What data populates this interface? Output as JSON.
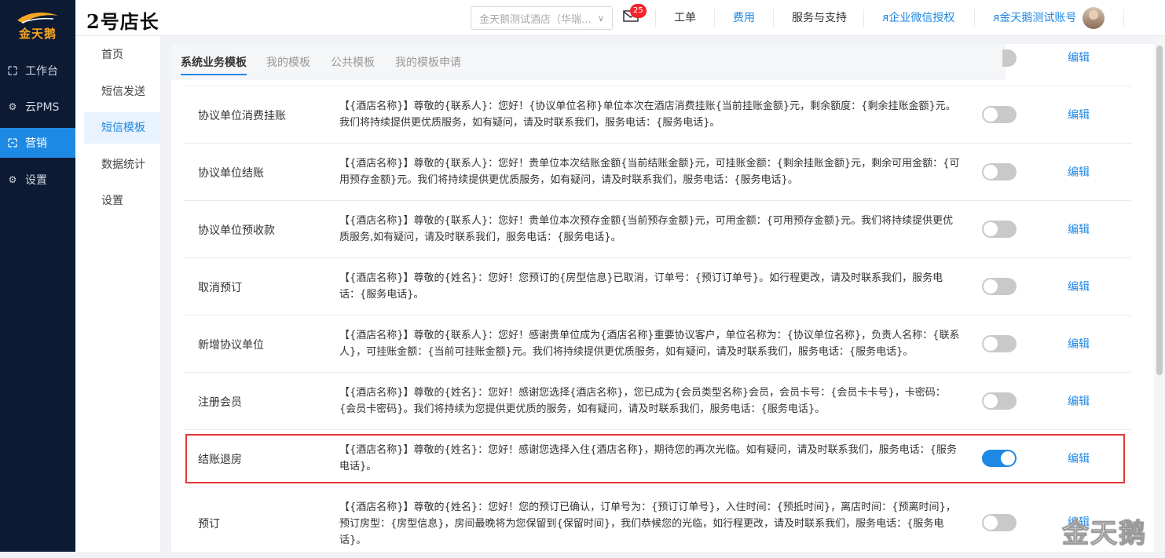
{
  "logo": {
    "text": "金天鹅"
  },
  "sidebar": {
    "items": [
      {
        "label": "工作台",
        "icon": "workbench-icon"
      },
      {
        "label": "云PMS",
        "icon": "gear-icon"
      },
      {
        "label": "营销",
        "icon": "marketing-icon",
        "active": true
      },
      {
        "label": "设置",
        "icon": "gear-icon"
      }
    ]
  },
  "header": {
    "brand": "2号店长",
    "hotel_select": "金天鹅测试酒店（华瑞...",
    "mail_badge": "25",
    "links": {
      "workorder": "工单",
      "fees": "费用",
      "support": "服务与支持",
      "wechat_auth": "企业微信授权",
      "account": "金天鹅测试账号"
    }
  },
  "subnav": {
    "items": [
      {
        "label": "首页"
      },
      {
        "label": "短信发送"
      },
      {
        "label": "短信模板",
        "active": true
      },
      {
        "label": "数据统计"
      },
      {
        "label": "设置"
      }
    ]
  },
  "tabs": [
    {
      "label": "系统业务模板",
      "active": true
    },
    {
      "label": "我的模板"
    },
    {
      "label": "公共模板"
    },
    {
      "label": "我的模板申请"
    }
  ],
  "edit_label": "编辑",
  "templates": [
    {
      "name": "",
      "content": "",
      "enabled": false
    },
    {
      "name": "协议单位消费挂账",
      "content": "【{酒店名称}】尊敬的{联系人}：您好！{协议单位名称}单位本次在酒店消费挂账{当前挂账金额}元，剩余额度：{剩余挂账金额}元。我们将持续提供更优质服务，如有疑问，请及时联系我们，服务电话：{服务电话}。",
      "enabled": false
    },
    {
      "name": "协议单位结账",
      "content": "【{酒店名称}】尊敬的{联系人}：您好！贵单位本次结账金额{当前结账金额}元，可挂账金额：{剩余挂账金额}元，剩余可用金额：{可用预存金额}元。我们将持续提供更优质服务，如有疑问，请及时联系我们，服务电话：{服务电话}。",
      "enabled": false
    },
    {
      "name": "协议单位预收款",
      "content": "【{酒店名称}】尊敬的{联系人}：您好！贵单位本次预存金额{当前预存金额}元，可用金额：{可用预存金额}元。我们将持续提供更优质服务,如有疑问，请及时联系我们，服务电话：{服务电话}。",
      "enabled": false
    },
    {
      "name": "取消预订",
      "content": "【{酒店名称}】尊敬的{姓名}：您好！您预订的{房型信息}已取消，订单号：{预订订单号}。如行程更改，请及时联系我们，服务电话：{服务电话}。",
      "enabled": false
    },
    {
      "name": "新增协议单位",
      "content": "【{酒店名称}】尊敬的{联系人}：您好！感谢贵单位成为{酒店名称}重要协议客户，单位名称为：{协议单位名称}，负责人名称：{联系人}，可挂账金额：{当前可挂账金额}元。我们将持续提供更优质服务，如有疑问，请及时联系我们，服务电话：{服务电话}。",
      "enabled": false
    },
    {
      "name": "注册会员",
      "content": "【{酒店名称}】尊敬的{姓名}：您好！感谢您选择{酒店名称}，您已成为{会员类型名称}会员，会员卡号：{会员卡卡号}，卡密码：{会员卡密码}。我们将持续为您提供更优质的服务，如有疑问，请及时联系我们，服务电话：{服务电话}。",
      "enabled": false
    },
    {
      "name": "结账退房",
      "content": "【{酒店名称}】尊敬的{姓名}：您好！感谢您选择入住{酒店名称}，期待您的再次光临。如有疑问，请及时联系我们，服务电话：{服务电话}。",
      "enabled": true
    },
    {
      "name": "预订",
      "content": "【{酒店名称}】尊敬的{姓名}：您好！您的预订已确认，订单号为：{预订订单号}，入住时间：{预抵时间}，离店时间：{预离时间}，预订房型：{房型信息}，房间最晚将为您保留到{保留时间}，我们恭候您的光临，如行程更改，请及时联系我们，服务电话：{服务电话}。",
      "enabled": false
    }
  ],
  "watermark": "金天鹅"
}
